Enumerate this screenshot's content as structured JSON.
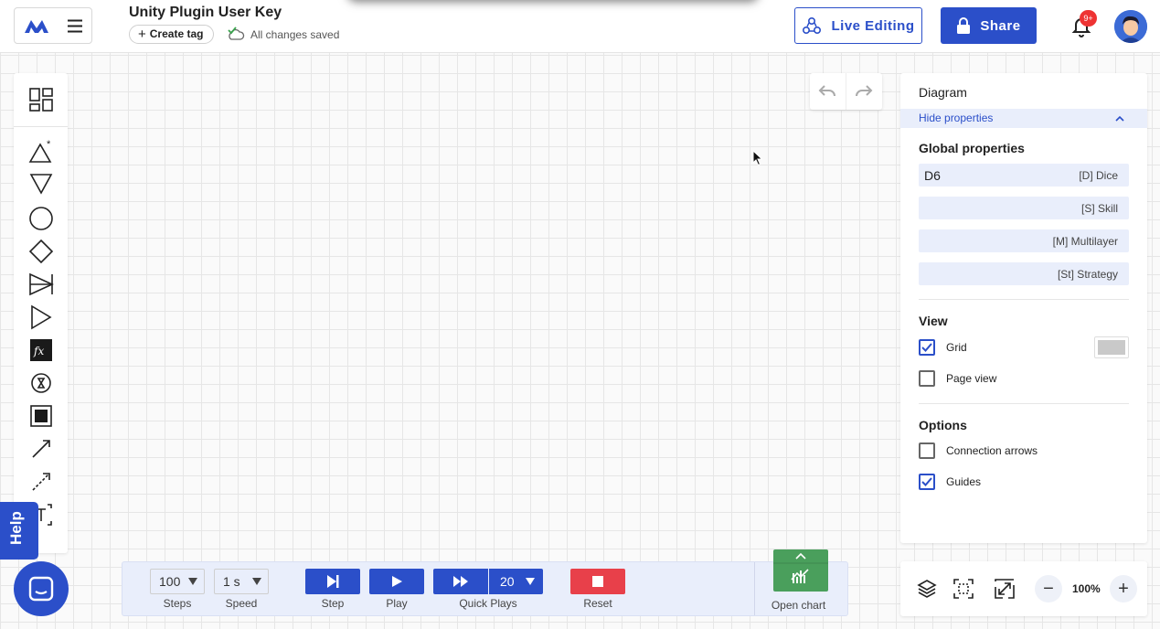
{
  "header": {
    "title": "Unity Plugin User Key",
    "create_tag_label": "Create tag",
    "save_status": "All changes saved",
    "live_editing_label": "Live Editing",
    "share_label": "Share",
    "notification_badge": "9+"
  },
  "help_label": "Help",
  "panel": {
    "title": "Diagram",
    "hide_properties_label": "Hide properties",
    "global_properties_title": "Global properties",
    "fields": [
      {
        "value": "D6",
        "label": "[D] Dice"
      },
      {
        "value": "",
        "label": "[S] Skill"
      },
      {
        "value": "",
        "label": "[M] Multilayer"
      },
      {
        "value": "",
        "label": "[St] Strategy"
      }
    ],
    "view_title": "View",
    "grid_label": "Grid",
    "grid_checked": true,
    "page_view_label": "Page view",
    "page_view_checked": false,
    "options_title": "Options",
    "connection_arrows_label": "Connection arrows",
    "connection_arrows_checked": false,
    "guides_label": "Guides",
    "guides_checked": true
  },
  "zoom": {
    "level": "100%"
  },
  "simulation": {
    "steps_value": "100",
    "steps_label": "Steps",
    "speed_value": "1 s",
    "speed_label": "Speed",
    "step_label": "Step",
    "play_label": "Play",
    "quick_plays_value": "20",
    "quick_plays_label": "Quick Plays",
    "reset_label": "Reset",
    "open_chart_label": "Open chart"
  },
  "colors": {
    "accent": "#2b4fc9",
    "reset": "#e8404a",
    "chart": "#4a9f5c",
    "badge": "#e33333"
  }
}
